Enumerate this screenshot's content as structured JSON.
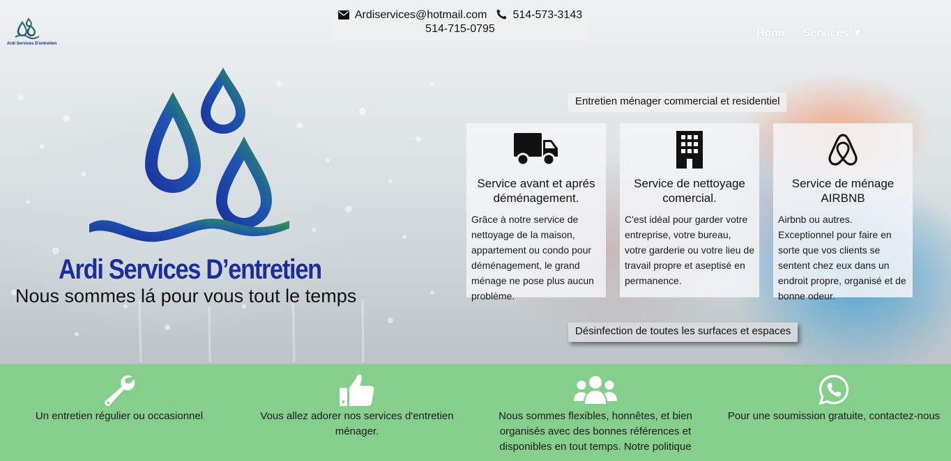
{
  "header": {
    "email": "Ardiservices@hotmail.com",
    "phone1": "514-573-3143",
    "phone2": "514-715-0795",
    "small_logo_caption": "Ardi Services D'entretien"
  },
  "nav": {
    "home": "Home",
    "services": "Services ▼"
  },
  "hero": {
    "brand": "Ardi Services D’entretien",
    "tagline": "Nous sommes lá pour vous tout le temps",
    "section_title": "Entretien ménager commercial et residentiel",
    "bottom_title": "Désinfection de toutes les surfaces et espaces"
  },
  "cards": [
    {
      "icon": "truck-icon",
      "title": "Service avant et aprés déménagement.",
      "text": "Grâce à notre service de nettoyage de la maison, appartement ou condo pour déménagement, le grand ménage ne pose plus aucun problème."
    },
    {
      "icon": "building-icon",
      "title": "Service de nettoyage comercial.",
      "text": "C'est idéal pour garder votre entreprise, votre bureau, votre garderie ou votre lieu de travail propre et aseptisé en permanence."
    },
    {
      "icon": "airbnb-icon",
      "title": "Service de ménage AIRBNB",
      "text": "Airbnb ou autres. Exceptionnel pour faire en sorte que vos clients se sentent chez eux dans un endroit propre, organisé et de bonne odeur."
    }
  ],
  "features": [
    {
      "icon": "wrench-icon",
      "text": "Un entretien régulier ou occasionnel"
    },
    {
      "icon": "thumbs-up-icon",
      "text": "Vous allez adorer nos services d'entretien ménager."
    },
    {
      "icon": "users-icon",
      "text": "Nous sommes flexibles, honnêtes, et bien organisés avec des bonnes références et disponibles en tout temps. Notre politique"
    },
    {
      "icon": "whatsapp-icon",
      "text": "Pour une soumission gratuite, contactez-nous"
    }
  ],
  "colors": {
    "brand_blue": "#1b2f9b",
    "brand_green": "#2e9e3a",
    "band_green": "#86ce8b"
  }
}
